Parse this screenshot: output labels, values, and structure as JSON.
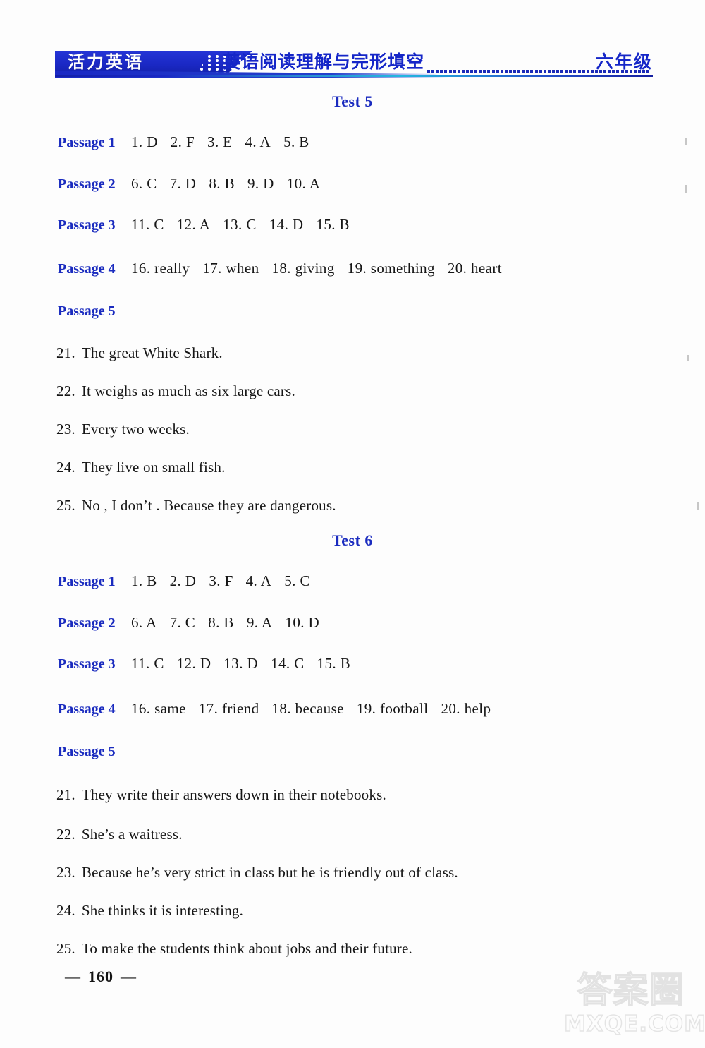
{
  "header": {
    "brand": "活力英语",
    "title": "英语阅读理解与完形填空",
    "grade": "六年级",
    "accent_color": "#1a2bbf"
  },
  "tests": [
    {
      "heading": "Test 5",
      "passages": [
        {
          "label": "Passage 1",
          "items": [
            "1. D",
            "2. F",
            "3. E",
            "4. A",
            "5. B"
          ]
        },
        {
          "label": "Passage 2",
          "items": [
            "6. C",
            "7. D",
            "8. B",
            "9. D",
            "10. A"
          ]
        },
        {
          "label": "Passage 3",
          "items": [
            "11. C",
            "12. A",
            "13. C",
            "14. D",
            "15. B"
          ]
        },
        {
          "label": "Passage 4",
          "items": [
            "16. really",
            "17. when",
            "18. giving",
            "19. something",
            "20. heart"
          ]
        },
        {
          "label": "Passage 5",
          "items": []
        }
      ],
      "answers": [
        {
          "num": "21.",
          "text": "The great White Shark."
        },
        {
          "num": "22.",
          "text": "It weighs as much as six large cars."
        },
        {
          "num": "23.",
          "text": "Every two weeks."
        },
        {
          "num": "24.",
          "text": "They live on small fish."
        },
        {
          "num": "25.",
          "text": "No , I don’t . Because they are dangerous."
        }
      ]
    },
    {
      "heading": "Test 6",
      "passages": [
        {
          "label": "Passage 1",
          "items": [
            "1. B",
            "2. D",
            "3. F",
            "4. A",
            "5. C"
          ]
        },
        {
          "label": "Passage 2",
          "items": [
            "6. A",
            "7. C",
            "8. B",
            "9. A",
            "10. D"
          ]
        },
        {
          "label": "Passage 3",
          "items": [
            "11. C",
            "12. D",
            "13. D",
            "14. C",
            "15. B"
          ]
        },
        {
          "label": "Passage 4",
          "items": [
            "16. same",
            "17. friend",
            "18. because",
            "19. football",
            "20. help"
          ]
        },
        {
          "label": "Passage 5",
          "items": []
        }
      ],
      "answers": [
        {
          "num": "21.",
          "text": "They write their answers down in their notebooks."
        },
        {
          "num": "22.",
          "text": "She’s a waitress."
        },
        {
          "num": "23.",
          "text": "Because he’s very strict in class but he is friendly out of class."
        },
        {
          "num": "24.",
          "text": "She thinks it is interesting."
        },
        {
          "num": "25.",
          "text": "To make the students think about jobs and their future."
        }
      ]
    }
  ],
  "footer": {
    "dash_left": "—",
    "page_number": "160",
    "dash_right": "—"
  },
  "watermark": {
    "chinese": "答案圈",
    "domain": "MXQE.COM"
  }
}
